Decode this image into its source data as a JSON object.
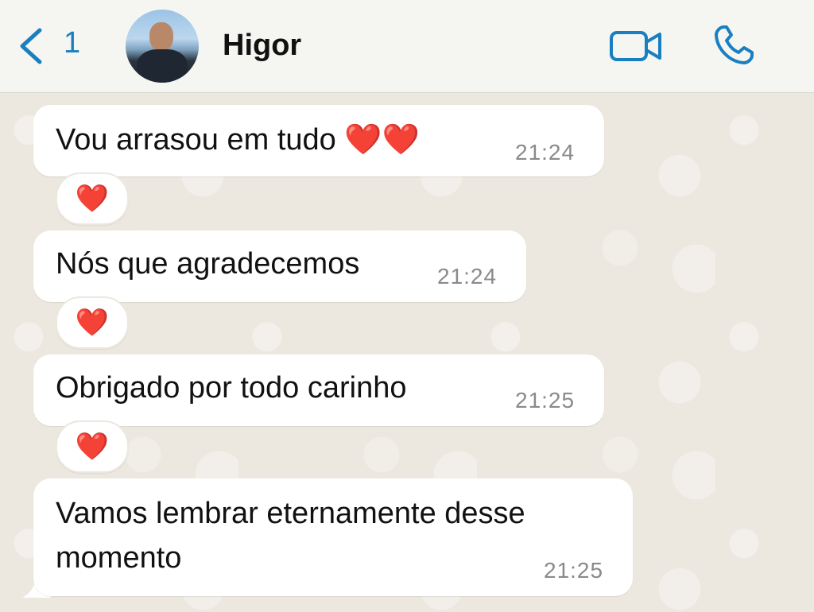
{
  "header": {
    "back_count": "1",
    "contact_name": "Higor"
  },
  "messages": [
    {
      "text": "Vou arrasou em tudo ❤️❤️",
      "time": "21:24",
      "reaction": "❤️"
    },
    {
      "text": "Nós que agradecemos",
      "time": "21:24",
      "reaction": "❤️"
    },
    {
      "text": "Obrigado por todo carinho",
      "time": "21:25",
      "reaction": "❤️"
    },
    {
      "text_line1": "Vamos lembrar eternamente desse",
      "text_line2": "momento",
      "time": "21:25"
    }
  ],
  "colors": {
    "accent": "#1a7fc1",
    "chat_background": "#ece7df",
    "bubble": "#ffffff",
    "timestamp": "#8a8a8a"
  },
  "icons": [
    "chevron-left-icon",
    "video-call-icon",
    "phone-icon",
    "heart-icon"
  ]
}
